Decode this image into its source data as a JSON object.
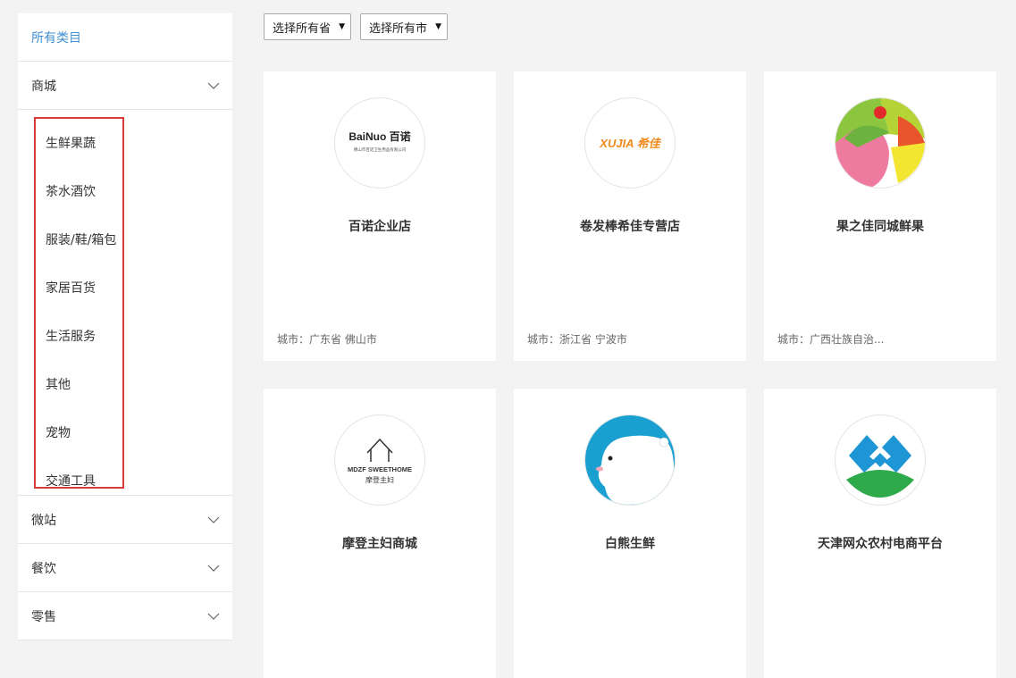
{
  "sidebar": {
    "all_label": "所有类目",
    "groups": [
      {
        "label": "商城"
      },
      {
        "label": "微站"
      },
      {
        "label": "餐饮"
      },
      {
        "label": "零售"
      }
    ],
    "sub_items": [
      "生鲜果蔬",
      "茶水酒饮",
      "服装/鞋/箱包",
      "家居百货",
      "生活服务",
      "其他",
      "宠物",
      "交通工具"
    ]
  },
  "filters": {
    "province": "选择所有省",
    "city": "选择所有市"
  },
  "city_prefix": "城市：",
  "stores": [
    {
      "name": "百诺企业店",
      "city": "广东省 佛山市",
      "logo": "bainuo-logo",
      "logo_text": "BaiNuo 百诺",
      "logo_sub": "佛山市百诺卫生用品有限公司"
    },
    {
      "name": "卷发棒希佳专营店",
      "city": "浙江省 宁波市",
      "logo": "xujia-logo",
      "logo_text": "XUJIA 希佳"
    },
    {
      "name": "果之佳同城鲜果",
      "city": "广西壮族自治...",
      "logo": "fruit-logo"
    },
    {
      "name": "摩登主妇商城",
      "city": "",
      "logo": "mdzf-logo",
      "logo_text": "MDZF SWEETHOME",
      "logo_sub": "摩登主妇"
    },
    {
      "name": "白熊生鲜",
      "city": "",
      "logo": "polar-bear-logo"
    },
    {
      "name": "天津网众农村电商平台",
      "city": "",
      "logo": "wangzhong-logo"
    }
  ]
}
